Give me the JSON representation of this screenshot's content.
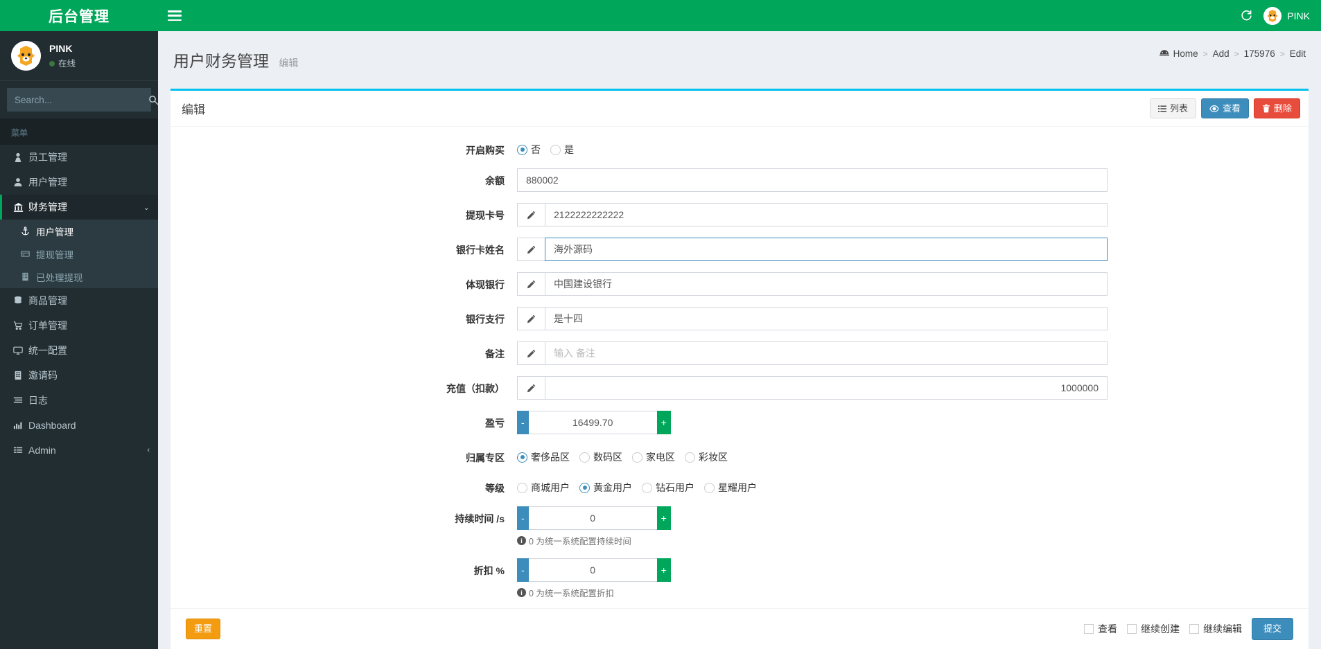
{
  "sidebar": {
    "logo": "后台管理",
    "user": {
      "name": "PINK",
      "status": "在线"
    },
    "search": {
      "placeholder": "Search...",
      "value": ""
    },
    "menu_header": "菜单",
    "items": [
      {
        "label": "员工管理",
        "icon": "user-tie-icon",
        "active": false
      },
      {
        "label": "用户管理",
        "icon": "user-icon",
        "active": false
      },
      {
        "label": "财务管理",
        "icon": "bank-icon",
        "active": true,
        "chevron": "⌄"
      },
      {
        "label": "商品管理",
        "icon": "database-icon",
        "active": false
      },
      {
        "label": "订单管理",
        "icon": "cart-icon",
        "active": false
      },
      {
        "label": "统一配置",
        "icon": "desktop-icon",
        "active": false
      },
      {
        "label": "邀请码",
        "icon": "building-icon",
        "active": false
      },
      {
        "label": "日志",
        "icon": "list-icon",
        "active": false
      },
      {
        "label": "Dashboard",
        "icon": "chart-bar-icon",
        "active": false
      },
      {
        "label": "Admin",
        "icon": "list-alt-icon",
        "active": false,
        "chevron": "‹"
      }
    ],
    "submenu": [
      {
        "label": "用户管理",
        "icon": "anchor-icon",
        "selected": true
      },
      {
        "label": "提现管理",
        "icon": "credit-card-icon",
        "selected": false
      },
      {
        "label": "已处理提现",
        "icon": "building-icon",
        "selected": false
      }
    ]
  },
  "topbar": {
    "menu_toggle": "hamburger-icon",
    "refresh": "refresh-icon",
    "user": "PINK"
  },
  "header": {
    "title": "用户财务管理",
    "subtitle": "编辑",
    "breadcrumb": [
      "Home",
      "Add",
      "175976",
      "Edit"
    ],
    "separator": ">"
  },
  "card": {
    "title": "编辑",
    "tools": [
      {
        "label": "列表",
        "icon": "list-icon",
        "style": "default"
      },
      {
        "label": "查看",
        "icon": "eye-icon",
        "style": "info"
      },
      {
        "label": "删除",
        "icon": "trash-icon",
        "style": "danger"
      }
    ]
  },
  "form": {
    "enable_purchase": {
      "label": "开启购买",
      "options": [
        "否",
        "是"
      ],
      "selected": 0
    },
    "balance": {
      "label": "余额",
      "value": "880002",
      "placeholder": ""
    },
    "withdraw_card": {
      "label": "提现卡号",
      "value": "2122222222222",
      "placeholder": "",
      "icon": "pencil-icon"
    },
    "bank_card_name": {
      "label": "银行卡姓名",
      "value": "海外源码",
      "placeholder": "",
      "icon": "pencil-icon",
      "focused": true
    },
    "bank": {
      "label": "体现银行",
      "value": "中国建设银行",
      "placeholder": "",
      "icon": "pencil-icon"
    },
    "branch": {
      "label": "银行支行",
      "value": "是十四",
      "placeholder": "",
      "icon": "pencil-icon"
    },
    "remark": {
      "label": "备注",
      "value": "",
      "placeholder": "输入 备注",
      "icon": "pencil-icon"
    },
    "recharge": {
      "label": "充值（扣款）",
      "value": "",
      "placeholder": "",
      "right_text": "1000000",
      "icon": "pencil-icon"
    },
    "profit_loss": {
      "label": "盈亏",
      "value": "16499.70",
      "minus": "-",
      "plus": "+"
    },
    "zone": {
      "label": "归属专区",
      "options": [
        "奢侈品区",
        "数码区",
        "家电区",
        "彩妆区"
      ],
      "selected": 0
    },
    "level": {
      "label": "等级",
      "options": [
        "商城用户",
        "黄金用户",
        "钻石用户",
        "星耀用户"
      ],
      "selected": 1
    },
    "duration": {
      "label": "持续时间 /s",
      "value": "0",
      "minus": "-",
      "plus": "+",
      "help": "0 为统一系统配置持续时间"
    },
    "discount": {
      "label": "折扣 %",
      "value": "0",
      "minus": "-",
      "plus": "+",
      "help": "0 为统一系统配置折扣"
    }
  },
  "footer": {
    "reset": "重置",
    "checkboxes": [
      "查看",
      "继续创建",
      "继续编辑"
    ],
    "submit": "提交"
  },
  "colors": {
    "brand_green": "#00a65a",
    "sidebar_dark": "#222d32",
    "card_accent": "#00c0ef",
    "info_blue": "#3c8dbc",
    "danger_red": "#e84c3d",
    "warning_orange": "#f39c12"
  }
}
